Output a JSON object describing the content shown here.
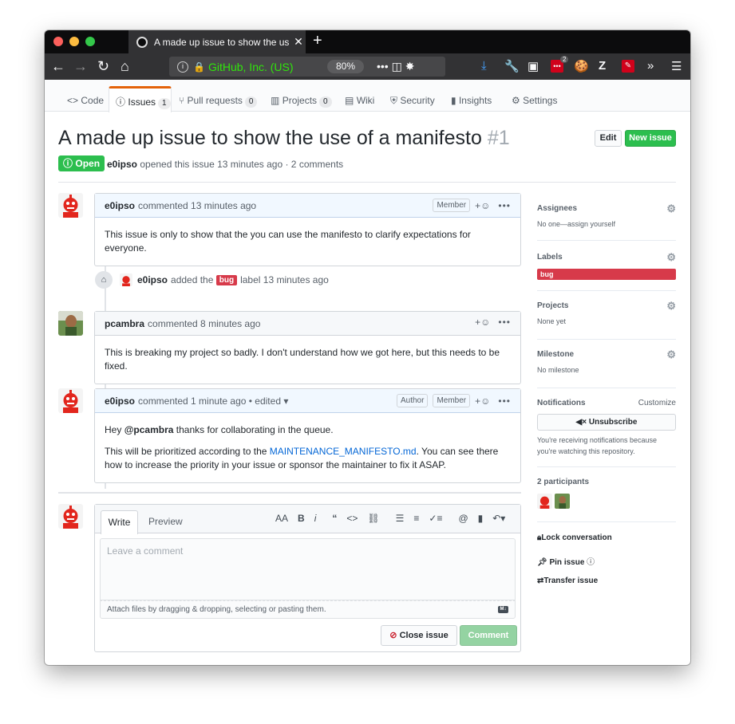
{
  "browser": {
    "tab_title": "A made up issue to show the us",
    "url_info_icon": "info-icon",
    "url_site": "GitHub, Inc. (US)",
    "zoom": "80%",
    "ext_badge": "2"
  },
  "repo_nav": {
    "code": "Code",
    "issues": "Issues",
    "issues_count": "1",
    "pulls": "Pull requests",
    "pulls_count": "0",
    "projects": "Projects",
    "projects_count": "0",
    "wiki": "Wiki",
    "security": "Security",
    "insights": "Insights",
    "settings": "Settings"
  },
  "issue": {
    "title": "A made up issue to show the use of a manifesto",
    "number": "#1",
    "edit_label": "Edit",
    "new_issue_label": "New issue",
    "state": "Open",
    "author": "e0ipso",
    "meta_text": "opened this issue 13 minutes ago · 2 comments"
  },
  "comments": [
    {
      "author": "e0ipso",
      "time": "commented 13 minutes ago",
      "badge": "Member",
      "body": "This issue is only to show that the you can use the manifesto to clarify expectations for everyone."
    },
    {
      "author": "pcambra",
      "time": "commented 8 minutes ago",
      "body": "This is breaking my project so badly. I don't understand how we got here, but this needs to be fixed."
    },
    {
      "author": "e0ipso",
      "time": "commented 1 minute ago • edited ▾",
      "badge_author": "Author",
      "badge": "Member",
      "body_p1_prefix": "Hey",
      "body_p1_mention": "@pcambra",
      "body_p1_suffix": "thanks for collaborating in the queue.",
      "body_p2_prefix": "This will be prioritized according to the",
      "body_p2_link": "MAINTENANCE_MANIFESTO.md",
      "body_p2_suffix": ". You can see there how to increase the priority in your issue or sponsor the maintainer to fix it ASAP."
    }
  ],
  "event": {
    "actor": "e0ipso",
    "text_before": "added the",
    "label": "bug",
    "text_after": "label 13 minutes ago"
  },
  "editor": {
    "write_tab": "Write",
    "preview_tab": "Preview",
    "placeholder": "Leave a comment",
    "attach_text": "Attach files by dragging & dropping, selecting or pasting them.",
    "close_label": "Close issue",
    "comment_label": "Comment"
  },
  "sidebar": {
    "assignees_h": "Assignees",
    "assignees_v": "No one—assign yourself",
    "labels_h": "Labels",
    "label_bug": "bug",
    "projects_h": "Projects",
    "projects_v": "None yet",
    "milestone_h": "Milestone",
    "milestone_v": "No milestone",
    "notifications_h": "Notifications",
    "customize": "Customize",
    "unsubscribe": "Unsubscribe",
    "notif_reason": "You're receiving notifications because you're watching this repository.",
    "participants_h": "2 participants",
    "lock": "Lock conversation",
    "pin": "Pin issue",
    "transfer": "Transfer issue"
  },
  "colors": {
    "open_green": "#2cbe4e",
    "bug_red": "#d73a4a",
    "link_blue": "#0366d6",
    "tab_orange": "#e36209"
  }
}
